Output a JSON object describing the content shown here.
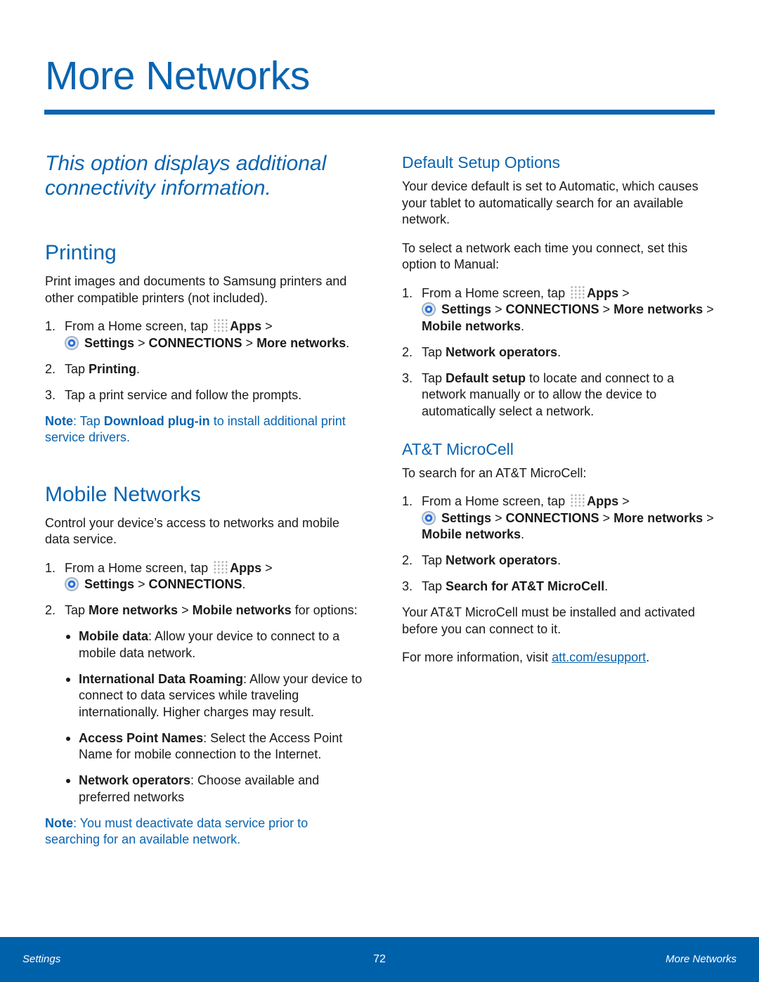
{
  "page_title": "More Networks",
  "colors": {
    "accent": "#0a64b0",
    "footer_bg": "#0061ab"
  },
  "left": [
    {
      "type": "intro",
      "segs": [
        {
          "t": "This option displays additional connectivity information."
        }
      ]
    },
    {
      "type": "h2",
      "segs": [
        {
          "t": "Printing"
        }
      ]
    },
    {
      "type": "p",
      "segs": [
        {
          "t": "Print images and documents to Samsung printers and other compatible printers (not included)."
        }
      ]
    },
    {
      "type": "li",
      "num": "1.",
      "segs": [
        {
          "t": "From a Home screen, tap "
        },
        {
          "icon": "apps-grid-icon"
        },
        {
          "t": "Apps",
          "b": true
        },
        {
          "t": " > "
        },
        {
          "icon": "settings-gear-icon",
          "br": true
        },
        {
          "t": "Settings",
          "b": true
        },
        {
          "t": " > "
        },
        {
          "t": "CONNECTIONS",
          "b": true
        },
        {
          "t": " > "
        },
        {
          "t": "More networks",
          "b": true
        },
        {
          "t": "."
        }
      ]
    },
    {
      "type": "li",
      "num": "2.",
      "segs": [
        {
          "t": "Tap "
        },
        {
          "t": "Printing",
          "b": true
        },
        {
          "t": "."
        }
      ]
    },
    {
      "type": "li",
      "num": "3.",
      "segs": [
        {
          "t": "Tap a print service and follow the prompts."
        }
      ]
    },
    {
      "type": "note",
      "segs": [
        {
          "t": "Note",
          "b": true
        },
        {
          "t": ": Tap "
        },
        {
          "t": "Download plug-in",
          "b": true
        },
        {
          "t": " to install additional print service drivers."
        }
      ]
    },
    {
      "type": "h2",
      "segs": [
        {
          "t": "Mobile Networks"
        }
      ]
    },
    {
      "type": "p",
      "segs": [
        {
          "t": "Control your device’s access to networks and mobile data service."
        }
      ]
    },
    {
      "type": "li",
      "num": "1.",
      "segs": [
        {
          "t": "From a Home screen, tap "
        },
        {
          "icon": "apps-grid-icon"
        },
        {
          "t": "Apps",
          "b": true
        },
        {
          "t": " > "
        },
        {
          "icon": "settings-gear-icon",
          "br": true
        },
        {
          "t": "Settings",
          "b": true
        },
        {
          "t": " > "
        },
        {
          "t": "CONNECTIONS",
          "b": true
        },
        {
          "t": "."
        }
      ]
    },
    {
      "type": "li",
      "num": "2.",
      "segs": [
        {
          "t": "Tap "
        },
        {
          "t": "More networks",
          "b": true
        },
        {
          "t": " > "
        },
        {
          "t": "Mobile networks",
          "b": true
        },
        {
          "t": " for options:"
        }
      ]
    },
    {
      "type": "bul",
      "segs": [
        {
          "t": "Mobile data",
          "b": true
        },
        {
          "t": ": Allow your device to connect to a mobile data network."
        }
      ]
    },
    {
      "type": "bul",
      "segs": [
        {
          "t": "International Data Roaming",
          "b": true
        },
        {
          "t": ": Allow your device to connect to data services while traveling internationally. Higher charges may result."
        }
      ]
    },
    {
      "type": "bul",
      "segs": [
        {
          "t": "Access Point Names",
          "b": true
        },
        {
          "t": ": Select the Access Point Name for mobile connection to the Internet."
        }
      ]
    },
    {
      "type": "bul",
      "segs": [
        {
          "t": "Network operators",
          "b": true
        },
        {
          "t": ": Choose available and preferred networks"
        }
      ]
    },
    {
      "type": "note",
      "segs": [
        {
          "t": "Note",
          "b": true
        },
        {
          "t": ": You must deactivate data service prior to searching for an available network."
        }
      ]
    }
  ],
  "right": [
    {
      "type": "h3",
      "segs": [
        {
          "t": "Default Setup Options"
        }
      ]
    },
    {
      "type": "p",
      "segs": [
        {
          "t": "Your device default is set to Automatic, which causes your tablet to automatically search for an available network."
        }
      ]
    },
    {
      "type": "p",
      "segs": [
        {
          "t": "To select a network each time you connect, set this option to Manual:"
        }
      ]
    },
    {
      "type": "li",
      "num": "1.",
      "segs": [
        {
          "t": "From a Home screen, tap "
        },
        {
          "icon": "apps-grid-icon"
        },
        {
          "t": "Apps",
          "b": true
        },
        {
          "t": " > "
        },
        {
          "icon": "settings-gear-icon",
          "br": true
        },
        {
          "t": "Settings",
          "b": true
        },
        {
          "t": " > "
        },
        {
          "t": "CONNECTIONS",
          "b": true
        },
        {
          "t": " > "
        },
        {
          "t": "More networks",
          "b": true
        },
        {
          "t": " > "
        },
        {
          "t": "Mobile networks",
          "b": true
        },
        {
          "t": "."
        }
      ]
    },
    {
      "type": "li",
      "num": "2.",
      "segs": [
        {
          "t": "Tap "
        },
        {
          "t": "Network operators",
          "b": true
        },
        {
          "t": "."
        }
      ]
    },
    {
      "type": "li",
      "num": "3.",
      "segs": [
        {
          "t": "Tap "
        },
        {
          "t": "Default setup",
          "b": true
        },
        {
          "t": " to locate and connect to a network manually or to allow the device to automatically select a network."
        }
      ]
    },
    {
      "type": "h3",
      "segs": [
        {
          "t": "AT&T MicroCell"
        }
      ]
    },
    {
      "type": "p",
      "segs": [
        {
          "t": "To search for an AT&T MicroCell:"
        }
      ]
    },
    {
      "type": "li",
      "num": "1.",
      "segs": [
        {
          "t": "From a Home screen, tap "
        },
        {
          "icon": "apps-grid-icon"
        },
        {
          "t": "Apps",
          "b": true
        },
        {
          "t": " > "
        },
        {
          "icon": "settings-gear-icon",
          "br": true
        },
        {
          "t": "Settings",
          "b": true
        },
        {
          "t": " > "
        },
        {
          "t": "CONNECTIONS",
          "b": true
        },
        {
          "t": " > "
        },
        {
          "t": "More networks",
          "b": true
        },
        {
          "t": " > "
        },
        {
          "t": "Mobile networks",
          "b": true
        },
        {
          "t": "."
        }
      ]
    },
    {
      "type": "li",
      "num": "2.",
      "segs": [
        {
          "t": "Tap "
        },
        {
          "t": "Network operators",
          "b": true
        },
        {
          "t": "."
        }
      ]
    },
    {
      "type": "li",
      "num": "3.",
      "segs": [
        {
          "t": "Tap "
        },
        {
          "t": "Search for AT&T MicroCell",
          "b": true
        },
        {
          "t": "."
        }
      ]
    },
    {
      "type": "p",
      "segs": [
        {
          "t": "Your AT&T MicroCell must be installed and activated before you can connect to it."
        }
      ]
    },
    {
      "type": "p",
      "segs": [
        {
          "t": "For more information, visit "
        },
        {
          "t": "att.com/esupport",
          "link": true
        },
        {
          "t": "."
        }
      ]
    }
  ],
  "footer": {
    "left": "Settings",
    "page_number": "72",
    "right": "More Networks"
  }
}
